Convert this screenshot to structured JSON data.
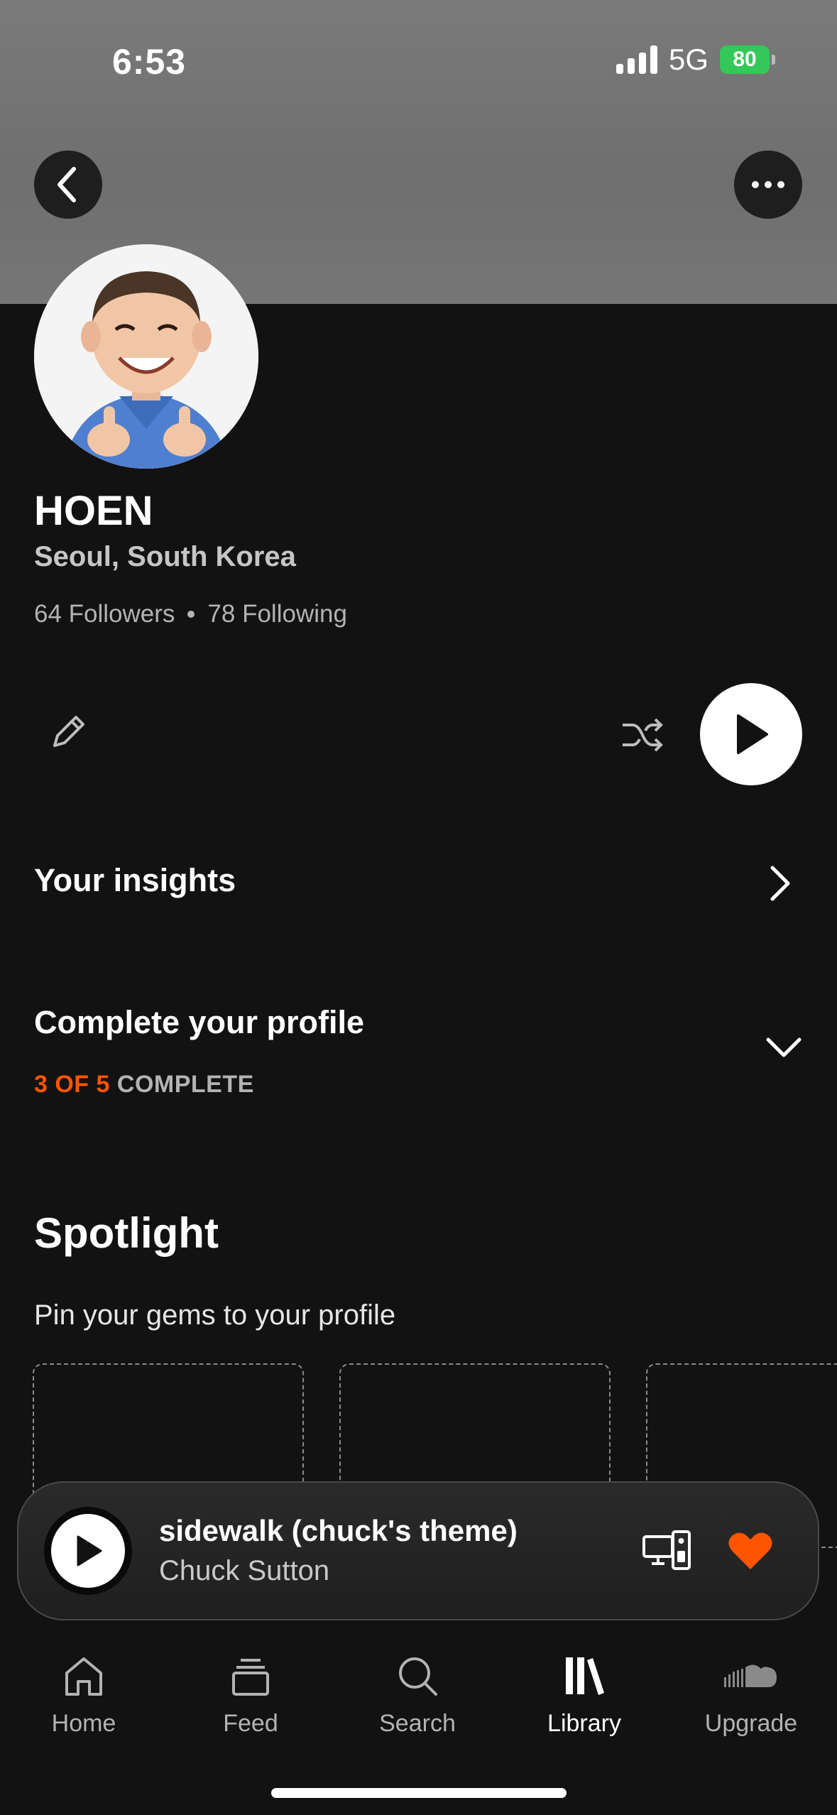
{
  "status_bar": {
    "time": "6:53",
    "network": "5G",
    "battery": "80"
  },
  "header": {
    "back_icon": "chevron-left-icon",
    "more_icon": "ellipsis-icon"
  },
  "profile": {
    "name": "HOEN",
    "location": "Seoul, South Korea",
    "followers": "64 Followers",
    "following": "78 Following"
  },
  "actions": {
    "edit_icon": "pencil-icon",
    "shuffle_icon": "shuffle-icon",
    "play_icon": "play-icon"
  },
  "insights": {
    "title": "Your insights"
  },
  "complete_profile": {
    "title": "Complete your profile",
    "progress_highlight": "3 OF 5",
    "progress_rest": "COMPLETE",
    "progress_fraction": 0.6
  },
  "spotlight": {
    "title": "Spotlight",
    "subtitle": "Pin your gems to your profile"
  },
  "mini_player": {
    "track_title": "sidewalk (chuck's theme)",
    "artist": "Chuck Sutton",
    "accent_color": "#ff5500"
  },
  "tabs": [
    {
      "label": "Home"
    },
    {
      "label": "Feed"
    },
    {
      "label": "Search"
    },
    {
      "label": "Library"
    },
    {
      "label": "Upgrade"
    }
  ],
  "colors": {
    "accent": "#ff5500",
    "background": "#121212",
    "battery": "#34c759"
  }
}
